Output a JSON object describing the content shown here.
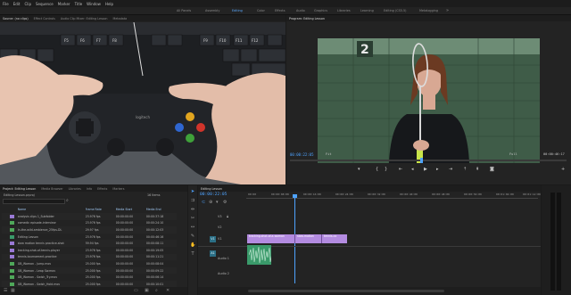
{
  "menu": [
    "File",
    "Edit",
    "Clip",
    "Sequence",
    "Marker",
    "Title",
    "Window",
    "Help"
  ],
  "workspaces": [
    "All Panels",
    "Assembly",
    "Editing",
    "Color",
    "Effects",
    "Audio",
    "Graphics",
    "Libraries",
    "Learning",
    "Editing (CS5.5)",
    "Metalogging"
  ],
  "active_workspace": "Editing",
  "source_monitor": {
    "tabs": [
      "Source: (no clips)",
      "Effect Controls",
      "Audio Clip Mixer: Editing Lesson",
      "Metadata"
    ],
    "video_subject": "Hands holding a Logitech gamepad in front of a keyboard",
    "keys": [
      "F5",
      "F6",
      "F7",
      "F8",
      "F9",
      "F10",
      "F11",
      "F12"
    ]
  },
  "program_monitor": {
    "title": "Program: Editing Lesson",
    "timecode": "00:00:22:05",
    "zoom": "Fit",
    "resolution": "Full",
    "duration": "00:00:46:17",
    "jersey_number": "2"
  },
  "project": {
    "tabs": [
      "Project: Editing Lesson",
      "Media Browser",
      "Libraries",
      "Info",
      "Effects",
      "Markers"
    ],
    "bin_path": "Editing Lesson.prproj",
    "item_count": "16 Items",
    "columns": [
      "Name",
      "Frame Rate",
      "Media Start",
      "Media End"
    ],
    "items": [
      {
        "name": "analysis clips 1_Subfolder",
        "rate": "23.976 fps",
        "start": "00:00:00:00",
        "end": "00:00:37:18",
        "color": "#9a7ad6"
      },
      {
        "name": "comedic episode-interview",
        "rate": "23.976 fps",
        "start": "00:00:00:00",
        "end": "00:00:24:10",
        "color": "#4fa85a"
      },
      {
        "name": "In-the-wild-ambience_25fps-DL",
        "rate": "29.97 fps",
        "start": "00:00:00:00",
        "end": "00:00:12:03",
        "color": "#4fa85a"
      },
      {
        "name": "Editing Lesson",
        "rate": "23.976 fps",
        "start": "00:00:00:00",
        "end": "00:00:46:16",
        "color": "#3a9a6a"
      },
      {
        "name": "slow motion tennis practice-shot",
        "rate": "59.94 fps",
        "start": "00:00:00:00",
        "end": "00:00:08:11",
        "color": "#9a7ad6"
      },
      {
        "name": "tracking-shot-of-tennis-player",
        "rate": "23.976 fps",
        "start": "00:00:00:00",
        "end": "00:00:19:05",
        "color": "#9a7ad6"
      },
      {
        "name": "tennis-tournament-practice",
        "rate": "23.976 fps",
        "start": "00:00:00:00",
        "end": "00:00:11:21",
        "color": "#9a7ad6"
      },
      {
        "name": "GB_Woman - Jump.mov",
        "rate": "25.000 fps",
        "start": "00:00:00:00",
        "end": "00:00:08:04",
        "color": "#4fa85a"
      },
      {
        "name": "GB_Woman - Leap Sw.mov",
        "rate": "25.000 fps",
        "start": "00:00:00:00",
        "end": "00:00:09:22",
        "color": "#4fa85a"
      },
      {
        "name": "GB_Woman - Swish_Try.mov",
        "rate": "25.000 fps",
        "start": "00:00:00:00",
        "end": "00:00:06:14",
        "color": "#4fa85a"
      },
      {
        "name": "GB_Woman - Swish_Hold.mov",
        "rate": "25.000 fps",
        "start": "00:00:00:00",
        "end": "00:00:10:01",
        "color": "#4fa85a"
      },
      {
        "name": "GB_Woman - Swift_Hold.mov",
        "rate": "25.000 fps",
        "start": "00:00:00:00",
        "end": "00:00:07:09",
        "color": "#4fa85a"
      }
    ]
  },
  "timeline": {
    "tab": "Editing Lesson",
    "timecode": "00:00:22:05",
    "ruler": [
      "00:00",
      "00:00:08:00",
      "00:00:16:00",
      "00:00:24:00",
      "00:00:32:00",
      "00:00:40:00",
      "00:00:48:00",
      "00:00:56:00",
      "00:01:04:00",
      "00:01:12:00",
      "00:01:20:00"
    ],
    "tracks": [
      "V3",
      "V2",
      "V1",
      "A1",
      "A2",
      "A3"
    ],
    "clip_labels": [
      "tracking-shot-of-a-woman",
      "slow-motion",
      "tennis-co"
    ],
    "v1_label": "V1",
    "a1_label": "Audio 1",
    "a2_label": "Audio 2",
    "a1_source": "A1"
  },
  "colors": {
    "accent": "#4ea3ff",
    "clip_video": "#b38be0",
    "clip_audio": "#3a9a6a",
    "track_btn": "#2b6f86"
  }
}
